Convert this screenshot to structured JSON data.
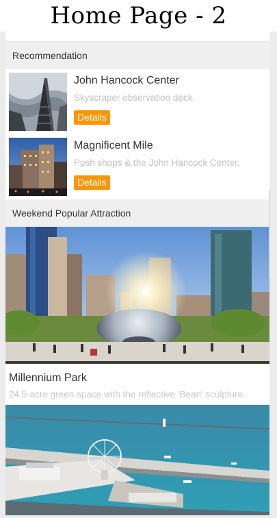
{
  "page_title": "Home Page - 2",
  "recommendation": {
    "header": "Recommendation",
    "items": [
      {
        "title": "John Hancock Center",
        "description": "Skyscraper observation deck.",
        "button": "Details",
        "image_icon": "skyscraper-photo"
      },
      {
        "title": "Magnificent Mile",
        "description": "Posh shops & the John Hancock Center.",
        "button": "Details",
        "image_icon": "city-night-photo"
      }
    ]
  },
  "weekend": {
    "header": "Weekend Popular Attraction",
    "items": [
      {
        "title": "Millennium Park",
        "description": "24.5-acre green space with the reflective 'Bean' sculpture.",
        "image_icon": "cloud-gate-photo"
      },
      {
        "image_icon": "navy-pier-photo"
      }
    ]
  },
  "colors": {
    "accent": "#ff9500",
    "header_bg": "#efefef",
    "muted_text": "#c4c4c4"
  }
}
